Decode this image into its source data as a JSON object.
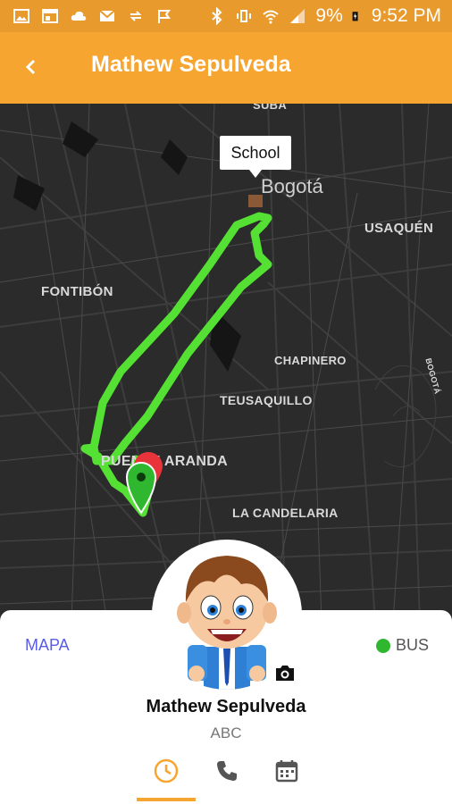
{
  "status_bar": {
    "battery": "9%",
    "time": "9:52 PM"
  },
  "header": {
    "title": "Mathew Sepulveda"
  },
  "map": {
    "labels": {
      "bogota": "Bogotá",
      "usaquen": "USAQUÉN",
      "fontibon": "FONTIBÓN",
      "chapinero": "CHAPINERO",
      "teusaquillo": "TEUSAQUILLO",
      "puente_aranda": "PUENTE ARANDA",
      "la_candelaria": "LA CANDELARIA",
      "bogota_road": "BOGOTÁ",
      "suba_partial": "SUBA"
    },
    "callout": "School",
    "route_color": "#55e034"
  },
  "sheet": {
    "mapa_label": "MAPA",
    "bus_label": "BUS",
    "name": "Mathew Sepulveda",
    "subtitle": "ABC",
    "tabs": [
      {
        "icon": "clock-icon",
        "active": true
      },
      {
        "icon": "phone-icon",
        "active": false
      },
      {
        "icon": "calendar-icon",
        "active": false
      }
    ]
  },
  "colors": {
    "accent": "#f7a531",
    "status_bar": "#e89a2c",
    "map_bg": "#2b2b2b",
    "bus_online": "#2fb82f",
    "mapa_text": "#5a5de6"
  }
}
